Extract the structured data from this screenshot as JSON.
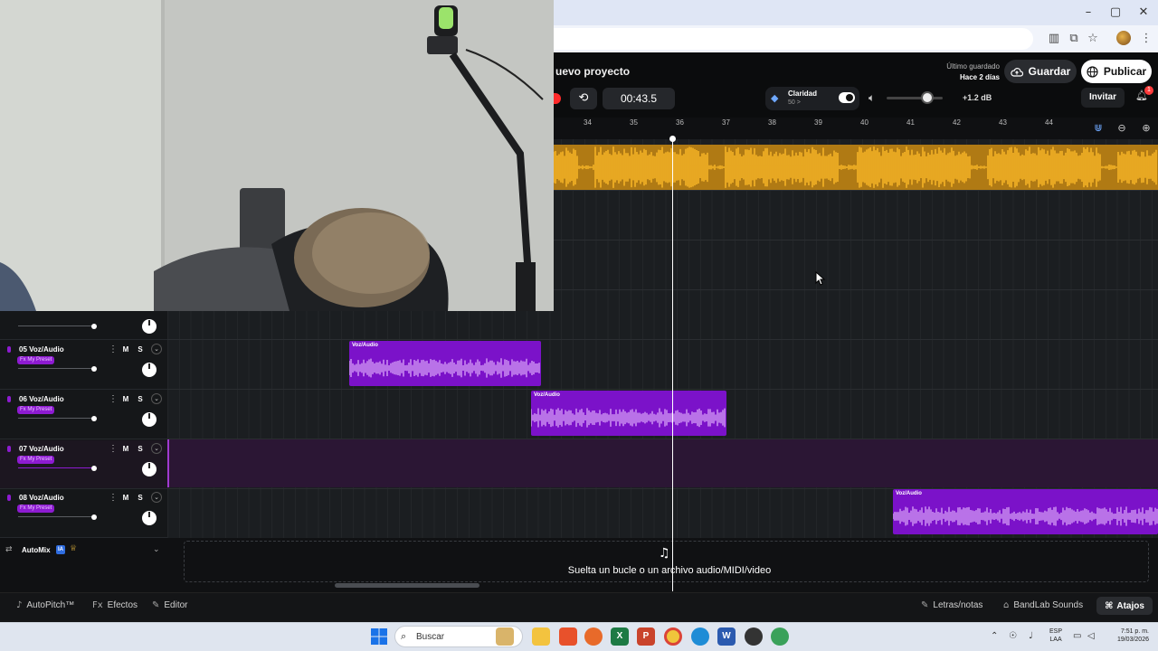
{
  "app": {
    "project_title": "uevo proyecto",
    "last_saved_label": "Último guardado",
    "last_saved_when": "Hace 2 días",
    "save_label": "Guardar",
    "publish_label": "Publicar",
    "time": "00:43.5",
    "clarity_label": "Claridad",
    "clarity_value": "50 >",
    "gain": "+1.2 dB",
    "invite_label": "Invitar",
    "notifications_count": "1",
    "accent_color": "#7b12c9",
    "clip_yellow": "#e8a31a"
  },
  "ruler": {
    "ticks": [
      "34",
      "35",
      "36",
      "37",
      "38",
      "39",
      "40",
      "41",
      "42",
      "43",
      "44"
    ]
  },
  "tracks": [
    {
      "name": "05 Voz/Audio",
      "fx": "Fx My Preset",
      "mute": "M",
      "solo": "S"
    },
    {
      "name": "06 Voz/Audio",
      "fx": "Fx My Preset",
      "mute": "M",
      "solo": "S"
    },
    {
      "name": "07 Voz/Audio",
      "fx": "Fx My Preset",
      "mute": "M",
      "solo": "S"
    },
    {
      "name": "08 Voz/Audio",
      "fx": "Fx My Preset",
      "mute": "M",
      "solo": "S"
    }
  ],
  "clips": [
    {
      "label": "Voz/Audio"
    },
    {
      "label": "Voz/Audio"
    },
    {
      "label": "Voz/Audio"
    }
  ],
  "automix": {
    "label": "AutoMix",
    "badge": "IA"
  },
  "dropzone": {
    "text": "Suelta un bucle o un archivo audio/MIDI/video"
  },
  "bottom_bar": {
    "autopitch": "AutoPitch™",
    "effects": "Efectos",
    "editor": "Editor",
    "lyrics": "Letras/notas",
    "sounds": "BandLab Sounds",
    "shortcuts": "Atajos"
  },
  "taskbar": {
    "search_placeholder": "Buscar",
    "lang_1": "ESP",
    "lang_2": "LAA",
    "time": "7:51 p. m.",
    "date": "19/03/2026"
  }
}
